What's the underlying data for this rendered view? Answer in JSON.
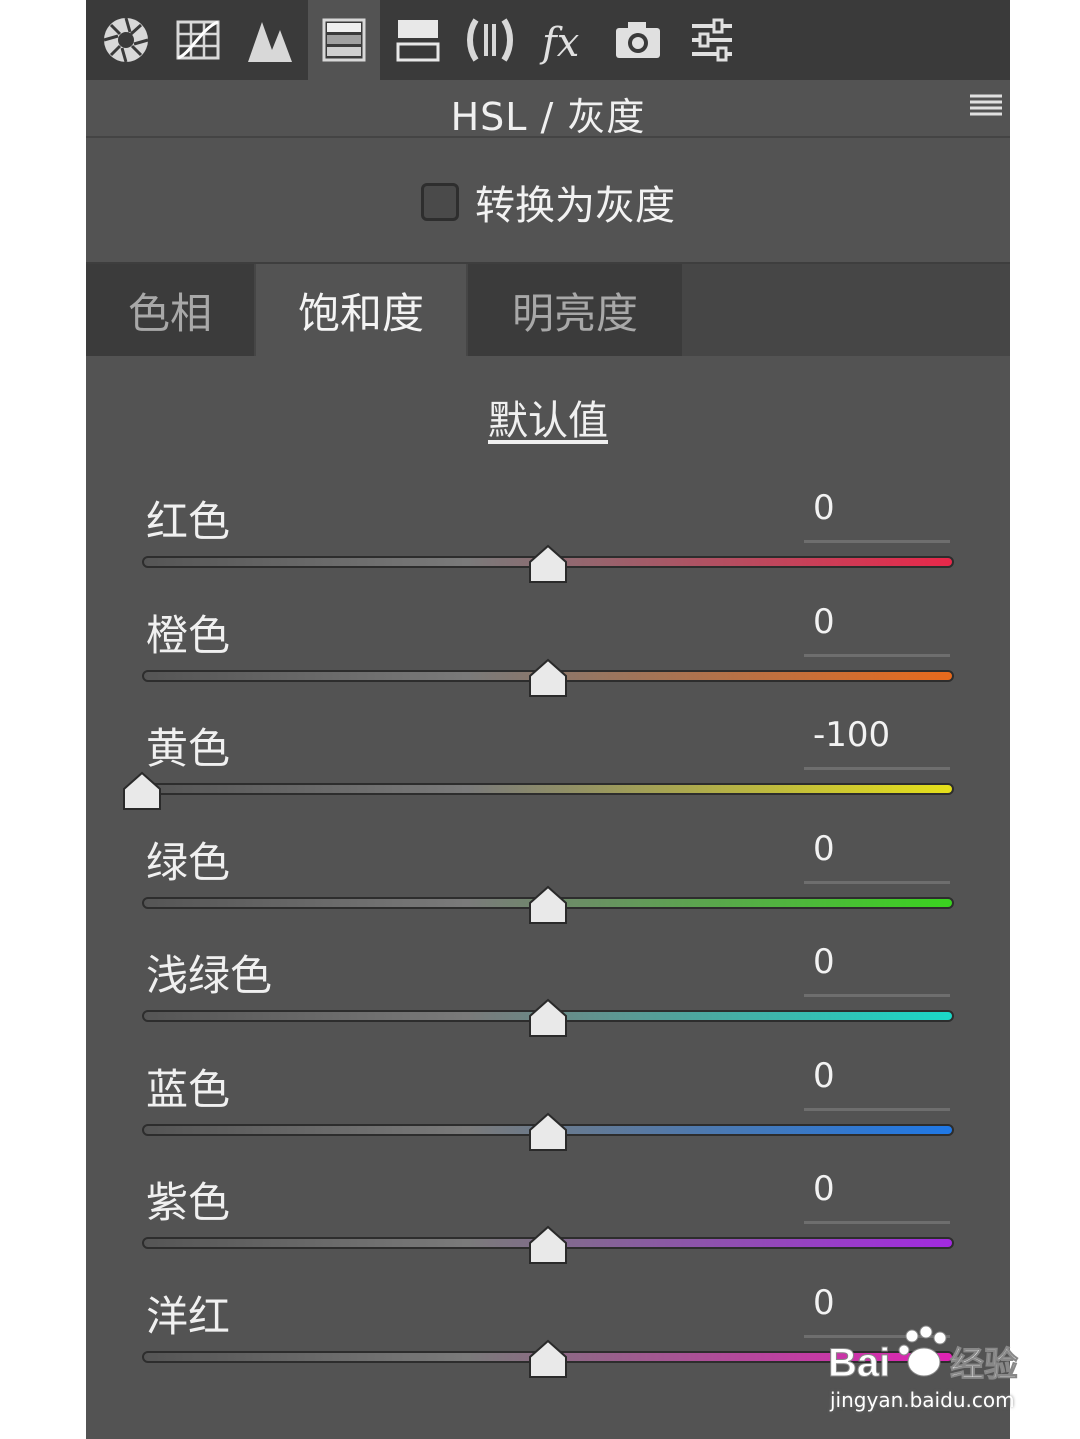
{
  "toolbar": {
    "tools": [
      {
        "icon": "aperture-icon"
      },
      {
        "icon": "tone-curve-icon"
      },
      {
        "icon": "detail-icon"
      },
      {
        "icon": "hsl-grayscale-icon",
        "active": true
      },
      {
        "icon": "split-toning-icon"
      },
      {
        "icon": "lens-corrections-icon"
      },
      {
        "icon": "effects-fx-icon"
      },
      {
        "icon": "camera-calibration-icon"
      },
      {
        "icon": "presets-sliders-icon"
      }
    ]
  },
  "header": {
    "title": "HSL / 灰度",
    "menu_icon": "panel-menu-icon"
  },
  "grayscale": {
    "label": "转换为灰度",
    "checked": false
  },
  "tabs": [
    {
      "label": "色相",
      "active": false
    },
    {
      "label": "饱和度",
      "active": true
    },
    {
      "label": "明亮度",
      "active": false
    }
  ],
  "default_link": "默认值",
  "sliders": [
    {
      "label": "红色",
      "value": "0",
      "color": "#e8284a"
    },
    {
      "label": "橙色",
      "value": "0",
      "color": "#e86a1c"
    },
    {
      "label": "黄色",
      "value": "-100",
      "color": "#e6e01a"
    },
    {
      "label": "绿色",
      "value": "0",
      "color": "#3ad31f"
    },
    {
      "label": "浅绿色",
      "value": "0",
      "color": "#1ad8c8"
    },
    {
      "label": "蓝色",
      "value": "0",
      "color": "#1f78e6"
    },
    {
      "label": "紫色",
      "value": "0",
      "color": "#a22ae0"
    },
    {
      "label": "洋红",
      "value": "0",
      "color": "#e022b4"
    }
  ],
  "watermark": {
    "brand": "Bai度经验",
    "url": "jingyan.baidu.com"
  }
}
